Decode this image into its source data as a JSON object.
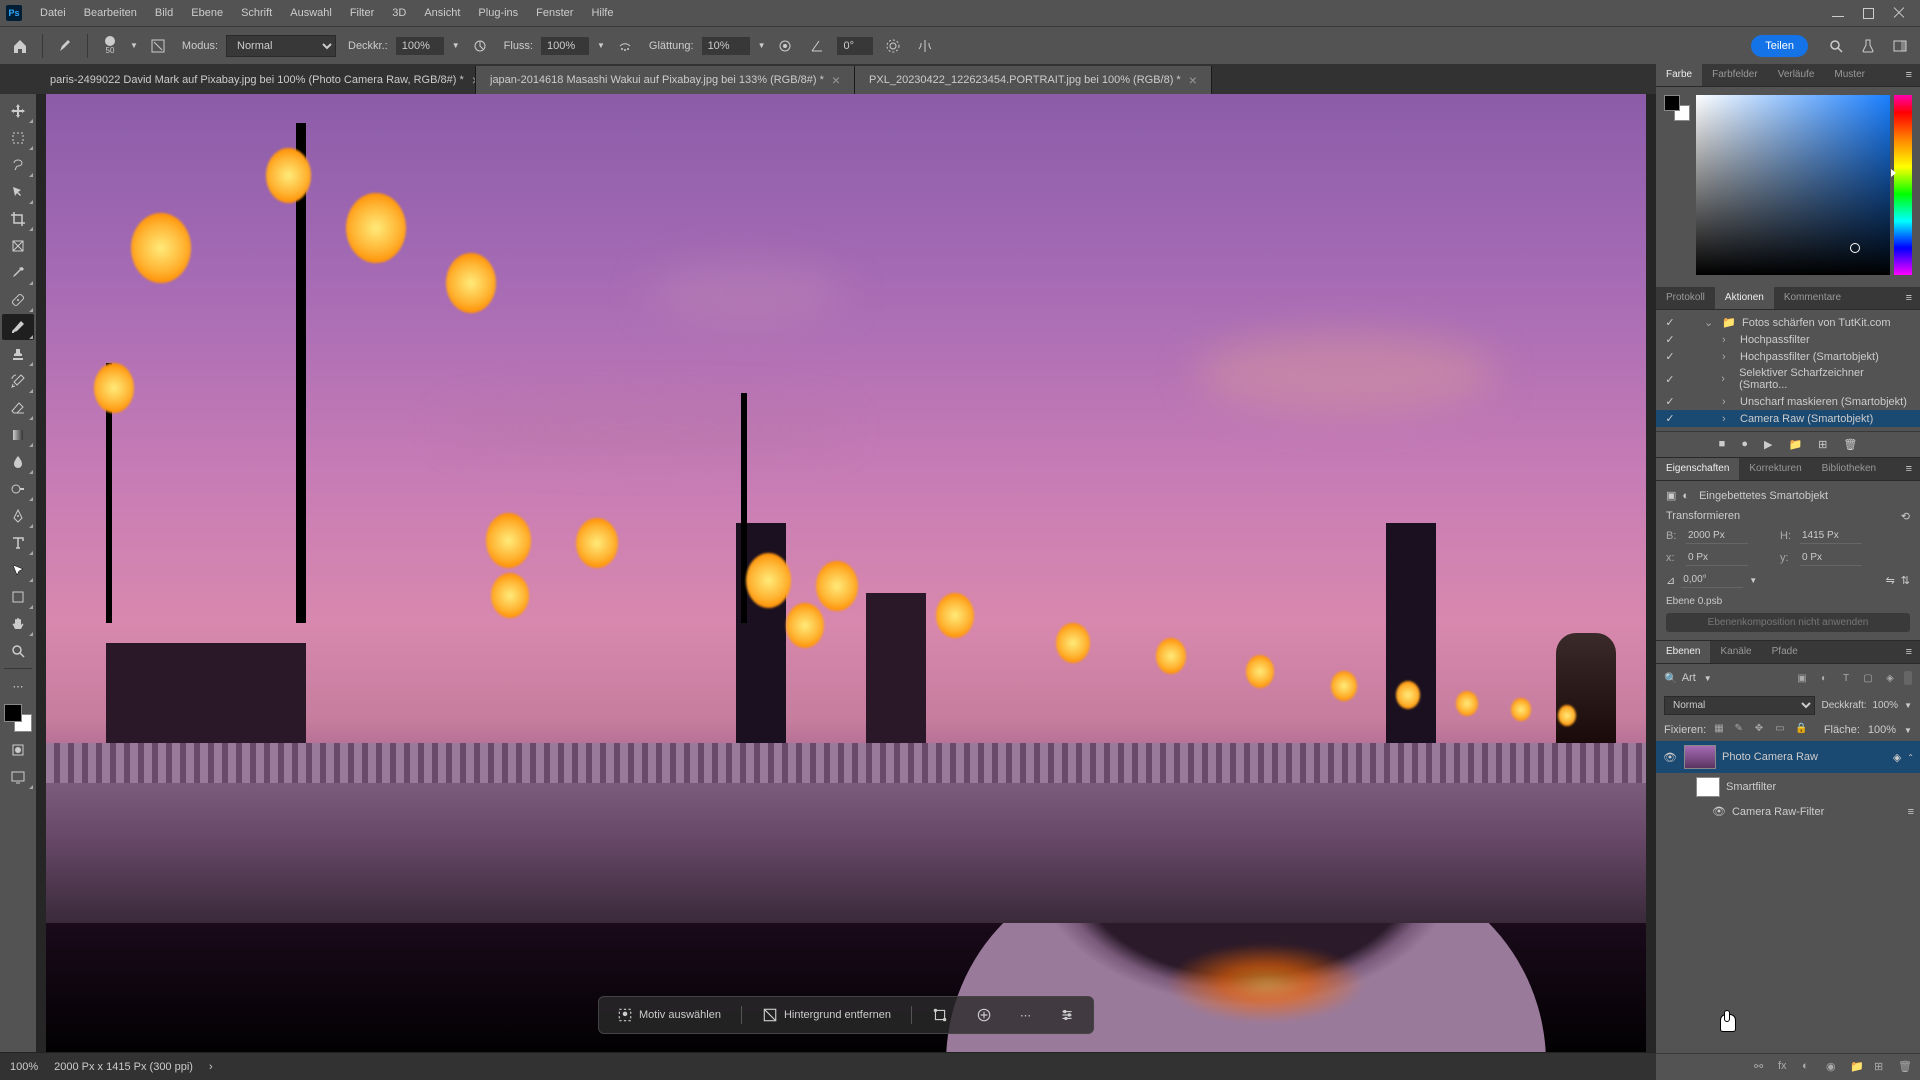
{
  "menubar": {
    "items": [
      "Datei",
      "Bearbeiten",
      "Bild",
      "Ebene",
      "Schrift",
      "Auswahl",
      "Filter",
      "3D",
      "Ansicht",
      "Plug-ins",
      "Fenster",
      "Hilfe"
    ]
  },
  "optionsbar": {
    "brush_size": "50",
    "mode_label": "Modus:",
    "mode_value": "Normal",
    "opacity_label": "Deckkr.:",
    "opacity_value": "100%",
    "flow_label": "Fluss:",
    "flow_value": "100%",
    "smoothing_label": "Glättung:",
    "smoothing_value": "10%",
    "angle_value": "0°",
    "share_label": "Teilen"
  },
  "tabs": [
    {
      "label": "paris-2499022 David Mark auf Pixabay.jpg bei 100% (Photo Camera Raw, RGB/8#) *",
      "active": true
    },
    {
      "label": "japan-2014618 Masashi Wakui auf Pixabay.jpg bei 133% (RGB/8#) *",
      "active": false
    },
    {
      "label": "PXL_20230422_122623454.PORTRAIT.jpg bei 100% (RGB/8) *",
      "active": false
    }
  ],
  "floating": {
    "select_subject": "Motiv auswählen",
    "remove_bg": "Hintergrund entfernen"
  },
  "color_panel": {
    "tabs": [
      "Farbe",
      "Farbfelder",
      "Verläufe",
      "Muster"
    ]
  },
  "actions_panel": {
    "tabs": [
      "Protokoll",
      "Aktionen",
      "Kommentare"
    ],
    "folder": "Fotos schärfen von TutKit.com",
    "items": [
      "Hochpassfilter",
      "Hochpassfilter (Smartobjekt)",
      "Selektiver Scharfzeichner (Smarto...",
      "Unscharf maskieren (Smartobjekt)",
      "Camera Raw (Smartobjekt)"
    ]
  },
  "properties_panel": {
    "tabs": [
      "Eigenschaften",
      "Korrekturen",
      "Bibliotheken"
    ],
    "type_label": "Eingebettetes Smartobjekt",
    "transform_label": "Transformieren",
    "width_label": "B:",
    "width_value": "2000 Px",
    "height_label": "H:",
    "height_value": "1415 Px",
    "x_label": "x:",
    "x_value": "0 Px",
    "y_label": "y:",
    "y_value": "0 Px",
    "angle_value": "0,00°",
    "layer_file": "Ebene 0.psb",
    "comp_label": "Ebenenkomposition nicht anwenden"
  },
  "layers_panel": {
    "tabs": [
      "Ebenen",
      "Kanäle",
      "Pfade"
    ],
    "search_label": "Art",
    "blend_mode": "Normal",
    "opacity_label": "Deckkraft:",
    "opacity_value": "100%",
    "lock_label": "Fixieren:",
    "fill_label": "Fläche:",
    "fill_value": "100%",
    "layers": [
      {
        "name": "Photo Camera Raw",
        "selected": true
      },
      {
        "name": "Smartfilter",
        "indent": true,
        "mask": true
      },
      {
        "name": "Camera Raw-Filter",
        "indent2": true
      }
    ]
  },
  "statusbar": {
    "zoom": "100%",
    "doc_info": "2000 Px x 1415 Px (300 ppi)"
  }
}
